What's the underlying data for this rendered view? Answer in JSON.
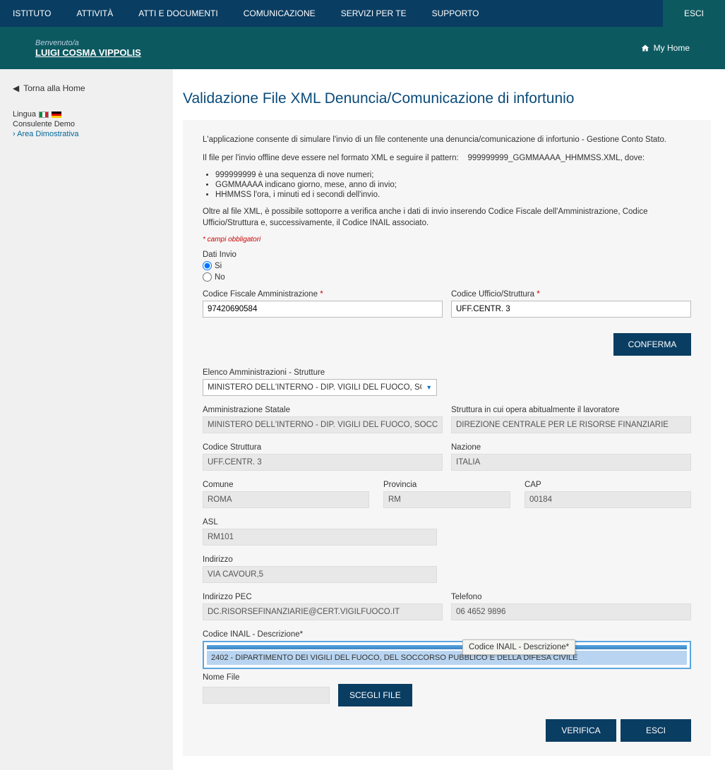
{
  "nav": {
    "items": [
      "ISTITUTO",
      "ATTIVITÀ",
      "ATTI E DOCUMENTI",
      "COMUNICAZIONE",
      "SERVIZI PER TE",
      "SUPPORTO"
    ],
    "esci": "ESCI"
  },
  "header": {
    "welcome": "Benvenuto/a",
    "username": "LUIGI COSMA VIPPOLIS",
    "myhome": "My Home"
  },
  "sidebar": {
    "back": "Torna alla Home",
    "lingua": "Lingua",
    "consulente": "Consulente Demo",
    "area": "Area Dimostrativa"
  },
  "page": {
    "title": "Validazione File XML Denuncia/Comunicazione di infortunio",
    "intro1": "L'applicazione consente di simulare l'invio di un file contenente una denuncia/comunicazione di infortunio - Gestione Conto Stato.",
    "intro2a": "Il file per l'invio offline deve essere nel formato XML e seguire il pattern:",
    "intro2b": "999999999_GGMMAAAA_HHMMSS.XML, dove:",
    "bullets": [
      "999999999 è una sequenza di nove numeri;",
      "GGMMAAAA indicano giorno, mese, anno di invio;",
      "HHMMSS l'ora, i minuti ed i secondi dell'invio."
    ],
    "intro3": "Oltre al file XML, è possibile sottoporre a verifica anche i dati di invio inserendo Codice Fiscale dell'Amministrazione, Codice Ufficio/Struttura e, successivamente, il Codice INAIL associato.",
    "mandatory": "* campi obbligatori"
  },
  "form": {
    "dati_invio_label": "Dati Invio",
    "si": "Si",
    "no": "No",
    "cf_label": "Codice Fiscale Amministrazione",
    "cf_value": "97420690584",
    "cu_label": "Codice Ufficio/Struttura",
    "cu_value": "UFF.CENTR. 3",
    "conferma": "CONFERMA",
    "elenco_label": "Elenco Amministrazioni - Strutture",
    "elenco_value": "MINISTERO DELL'INTERNO - DIP. VIGILI DEL FUOCO, SOC",
    "amm_label": "Amministrazione Statale",
    "amm_value": "MINISTERO DELL'INTERNO - DIP. VIGILI DEL FUOCO, SOCC",
    "struttura_lav_label": "Struttura in cui opera abitualmente il lavoratore",
    "struttura_lav_value": "DIREZIONE CENTRALE PER LE RISORSE FINANZIARIE",
    "cod_strutt_label": "Codice Struttura",
    "cod_strutt_value": "UFF.CENTR. 3",
    "nazione_label": "Nazione",
    "nazione_value": "ITALIA",
    "comune_label": "Comune",
    "comune_value": "ROMA",
    "provincia_label": "Provincia",
    "provincia_value": "RM",
    "cap_label": "CAP",
    "cap_value": "00184",
    "asl_label": "ASL",
    "asl_value": "RM101",
    "indirizzo_label": "Indirizzo",
    "indirizzo_value": "VIA CAVOUR,5",
    "pec_label": "Indirizzo PEC",
    "pec_value": "DC.RISORSEFINANZIARIE@CERT.VIGILFUOCO.IT",
    "tel_label": "Telefono",
    "tel_value": "06 4652 9896",
    "inail_label": "Codice INAIL - Descrizione*",
    "inail_option": "2402 - DIPARTIMENTO DEI VIGILI DEL FUOCO, DEL SOCCORSO PUBBLICO E DELLA DIFESA CIVILE",
    "nomefile_label": "Nome File",
    "scegli_file": "SCEGLI FILE",
    "verifica": "VERIFICA",
    "esci": "ESCI",
    "tooltip": "Codice INAIL - Descrizione*"
  }
}
